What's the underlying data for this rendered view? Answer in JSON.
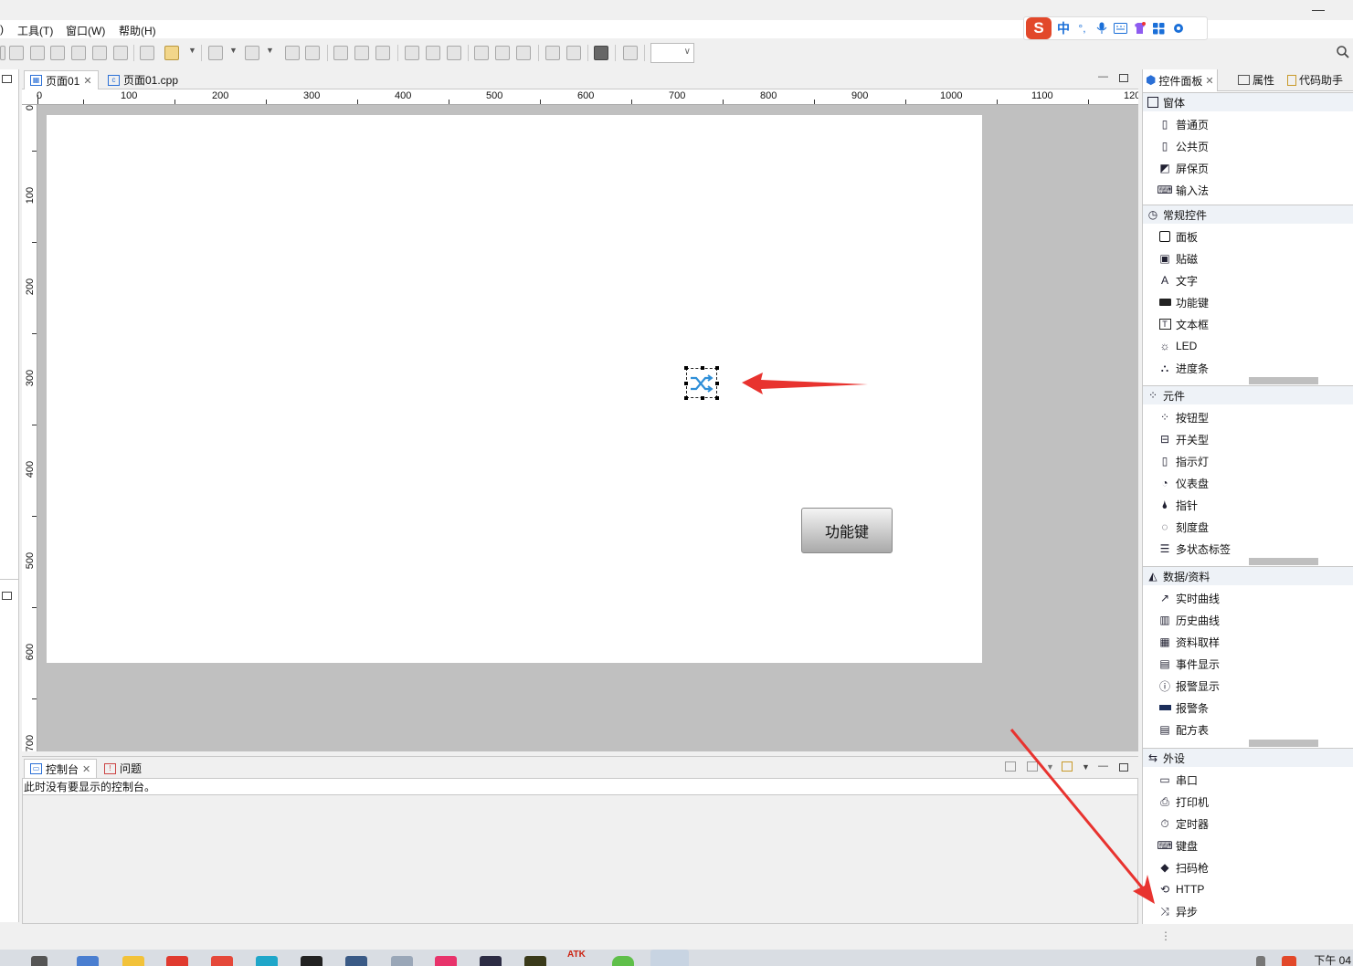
{
  "menu": {
    "items": [
      ")",
      "工具(T)",
      "窗口(W)",
      "帮助(H)"
    ]
  },
  "ime": {
    "logo": "S",
    "mode": "中",
    "punct": "°,"
  },
  "editor": {
    "tabs": [
      {
        "label": "页面01",
        "icon": "grid-page-icon",
        "active": true
      },
      {
        "label": "页面01.cpp",
        "icon": "cpp-file-icon",
        "active": false
      }
    ],
    "ruler_h": [
      "0",
      "100",
      "200",
      "300",
      "400",
      "500",
      "600",
      "700",
      "800",
      "900",
      "1000",
      "1100",
      "120"
    ],
    "ruler_v": [
      "0",
      "100",
      "200",
      "300",
      "400",
      "500",
      "600",
      "700"
    ],
    "canvas": {
      "button_label": "功能键",
      "async_widget_icon": "shuffle-icon"
    }
  },
  "console": {
    "tabs": [
      {
        "label": "控制台",
        "icon": "console-icon"
      },
      {
        "label": "问题",
        "icon": "problems-icon"
      }
    ],
    "message": "此时没有要显示的控制台。"
  },
  "panel": {
    "tabs": [
      {
        "label": "控件面板",
        "icon": "cube-icon",
        "active": true
      },
      {
        "label": "属性",
        "icon": "properties-icon",
        "active": false
      },
      {
        "label": "代码助手",
        "icon": "code-assist-icon",
        "active": false
      }
    ],
    "categories": [
      {
        "title": "窗体",
        "icon": "window-icon",
        "items": [
          {
            "label": "普通页",
            "icon": "page-icon"
          },
          {
            "label": "公共页",
            "icon": "common-page-icon"
          },
          {
            "label": "屏保页",
            "icon": "screensaver-icon"
          },
          {
            "label": "输入法",
            "icon": "keyboard-grid-icon"
          }
        ]
      },
      {
        "title": "常规控件",
        "icon": "clock-icon",
        "items": [
          {
            "label": "面板",
            "icon": "panel-icon"
          },
          {
            "label": "贴磁",
            "icon": "tiles-icon"
          },
          {
            "label": "文字",
            "icon": "text-a-icon"
          },
          {
            "label": "功能键",
            "icon": "btn-icon"
          },
          {
            "label": "文本框",
            "icon": "textbox-icon"
          },
          {
            "label": "LED",
            "icon": "bulb-icon"
          },
          {
            "label": "进度条",
            "icon": "progress-icon"
          }
        ]
      },
      {
        "title": "元件",
        "icon": "components-icon",
        "items": [
          {
            "label": "按钮型",
            "icon": "button-type-icon"
          },
          {
            "label": "开关型",
            "icon": "switch-icon"
          },
          {
            "label": "指示灯",
            "icon": "indicator-icon"
          },
          {
            "label": "仪表盘",
            "icon": "gauge-icon"
          },
          {
            "label": "指针",
            "icon": "pointer-icon"
          },
          {
            "label": "刻度盘",
            "icon": "dial-icon"
          },
          {
            "label": "多状态标签",
            "icon": "multistate-icon"
          }
        ]
      },
      {
        "title": "数据/资料",
        "icon": "area-chart-icon",
        "items": [
          {
            "label": "实时曲线",
            "icon": "line-chart-icon"
          },
          {
            "label": "历史曲线",
            "icon": "bar-chart-icon"
          },
          {
            "label": "资料取样",
            "icon": "table-icon"
          },
          {
            "label": "事件显示",
            "icon": "event-icon"
          },
          {
            "label": "报警显示",
            "icon": "alarm-icon"
          },
          {
            "label": "报警条",
            "icon": "alarm-bar-icon"
          },
          {
            "label": "配方表",
            "icon": "recipe-icon"
          }
        ]
      },
      {
        "title": "外设",
        "icon": "peripheral-icon",
        "items": [
          {
            "label": "串口",
            "icon": "serial-icon"
          },
          {
            "label": "打印机",
            "icon": "printer-icon"
          },
          {
            "label": "定时器",
            "icon": "timer-icon"
          },
          {
            "label": "键盘",
            "icon": "keyboard-icon"
          },
          {
            "label": "扫码枪",
            "icon": "scanner-icon"
          },
          {
            "label": "HTTP",
            "icon": "http-icon"
          },
          {
            "label": "异步",
            "icon": "shuffle-icon"
          }
        ]
      }
    ]
  },
  "taskbar": {
    "clock": "下午 04",
    "app_text": "ATK"
  },
  "colors": {
    "accent": "#2a6fd6",
    "annotation": "#e8332f",
    "canvas_bg": "#c0c0c0"
  }
}
